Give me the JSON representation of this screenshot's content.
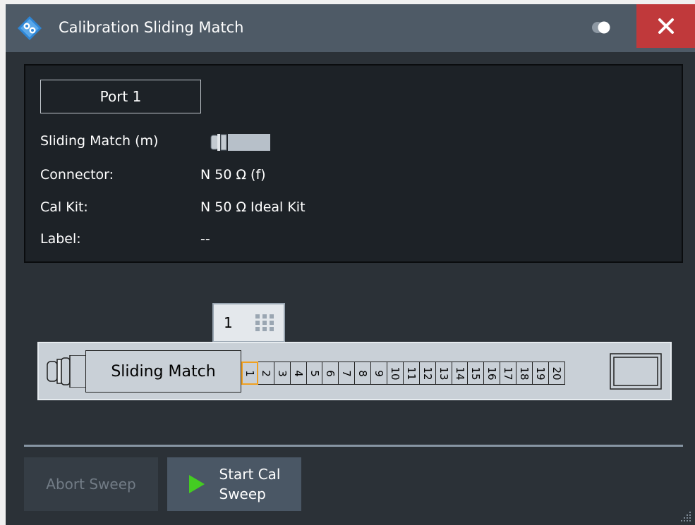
{
  "window": {
    "title": "Calibration Sliding Match",
    "icons": {
      "logo": "rohde-schwarz-logo",
      "toggle": "toggle-icon",
      "close": "close-icon"
    },
    "colors": {
      "titlebar": "#4e5a66",
      "close": "#c0393b",
      "background": "#2b3137"
    }
  },
  "info": {
    "port_tab": "Port 1",
    "standard_label": "Sliding Match (m)",
    "standard_icon": "sliding-match-connector-icon",
    "connector_label": "Connector:",
    "connector_value": "N 50 Ω (f)",
    "calkit_label": "Cal Kit:",
    "calkit_value": "N 50 Ω Ideal Kit",
    "label_label": "Label:",
    "label_value": "--"
  },
  "slider": {
    "current_position": "1",
    "body_label": "Sliding Match",
    "positions": [
      "1",
      "2",
      "3",
      "4",
      "5",
      "6",
      "7",
      "8",
      "9",
      "10",
      "11",
      "12",
      "13",
      "14",
      "15",
      "16",
      "17",
      "18",
      "19",
      "20"
    ],
    "selected_index": 0,
    "selected_color": "#f0a020"
  },
  "buttons": {
    "abort": "Abort Sweep",
    "start_line1": "Start Cal",
    "start_line2": "Sweep",
    "play_color": "#44cc22"
  }
}
